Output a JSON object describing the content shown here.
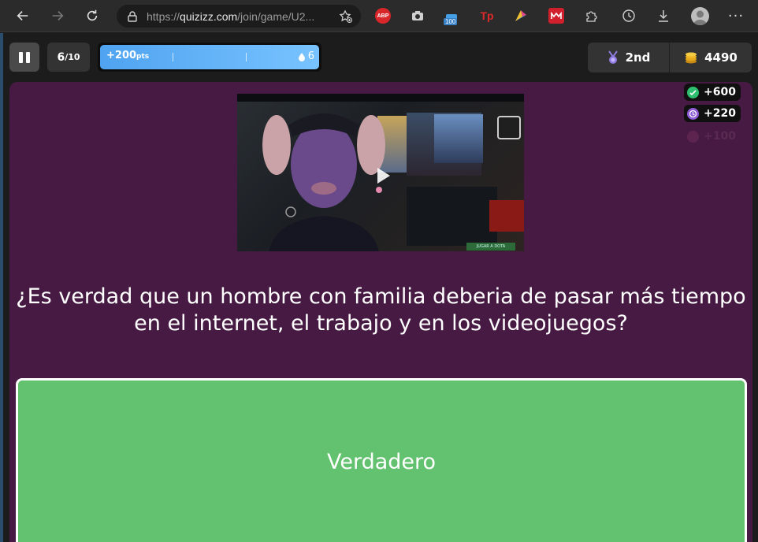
{
  "browser": {
    "url_prefix": "https://",
    "url_domain": "quizizz.com",
    "url_path": "/join/game/U2...",
    "extensions": [
      "adblock-plus",
      "camera",
      "counter-100",
      "tp",
      "fan",
      "m-extension",
      "puzzle"
    ],
    "ext_abp_label": "ABP",
    "ext_counter_badge": "100",
    "ext_tp_label": "Tp",
    "more_label": "···"
  },
  "topbar": {
    "question_current": "6",
    "question_total": "/10",
    "points_value": "+200",
    "points_unit": "pts",
    "streak": "6",
    "rank": "2nd",
    "coins": "4490"
  },
  "bonuses": {
    "correct": "+600",
    "time": "+220",
    "streak": "+100"
  },
  "video": {
    "button_label": "JUGAR A DOTA"
  },
  "question": {
    "text": "¿Es verdad que un hombre con familia deberia de pasar más tiempo en el internet, el trabajo y en los videojuegos?"
  },
  "answers": [
    {
      "label": "Verdadero",
      "color": "#63c26f"
    }
  ],
  "colors": {
    "panel_bg": "#461a42",
    "points_bar": "#4fa3f0",
    "answer_green": "#63c26f"
  }
}
